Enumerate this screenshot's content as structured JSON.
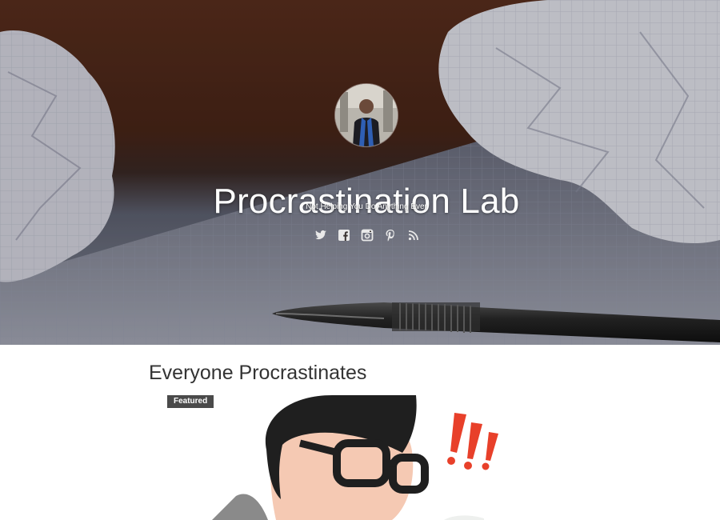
{
  "site": {
    "title": "Procrastination Lab",
    "tagline": "Not Helping You Do Anything Ever"
  },
  "social_links": [
    {
      "name": "twitter-icon"
    },
    {
      "name": "facebook-icon"
    },
    {
      "name": "instagram-icon"
    },
    {
      "name": "pinterest-icon"
    },
    {
      "name": "rss-icon"
    }
  ],
  "post": {
    "title": "Everyone Procrastinates",
    "badge": "Featured"
  },
  "colors": {
    "hero_wood": "#5b2f1e",
    "title_text": "#333333",
    "badge_bg": "#4a4a4a",
    "exclamation": "#e8402a"
  }
}
